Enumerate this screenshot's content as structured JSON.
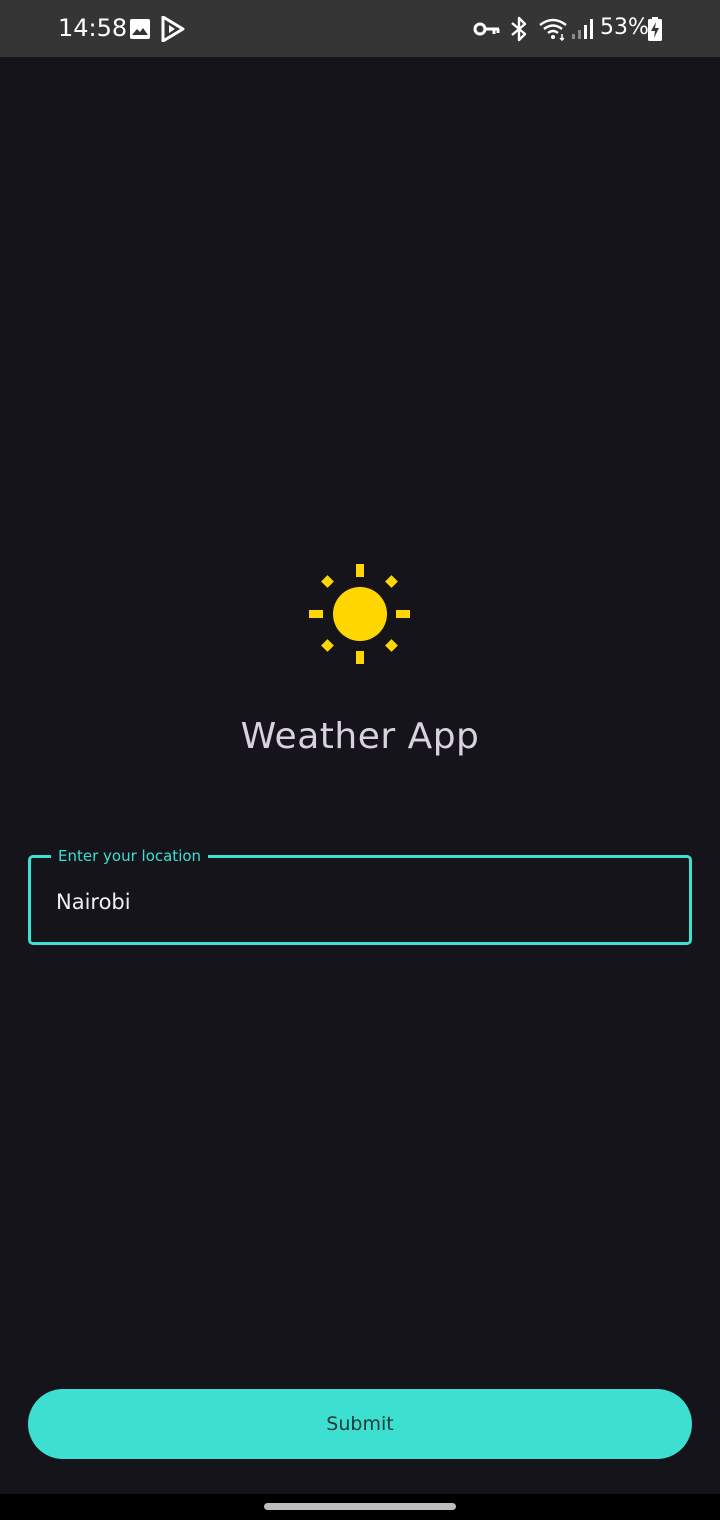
{
  "status_bar": {
    "time": "14:58",
    "battery_percent": "53%",
    "icons": [
      "gallery-icon",
      "play-store-icon",
      "vpn-key-icon",
      "bluetooth-icon",
      "wifi-icon",
      "cell-signal-icon",
      "battery-charging-icon"
    ]
  },
  "app": {
    "icon": "sun-icon",
    "title": "Weather App"
  },
  "location_field": {
    "label": "Enter your location",
    "value": "Nairobi"
  },
  "submit": {
    "label": "Submit"
  },
  "colors": {
    "background": "#16141b",
    "accent": "#3ddfd0",
    "sun": "#ffd600",
    "status_bar": "#353535"
  }
}
